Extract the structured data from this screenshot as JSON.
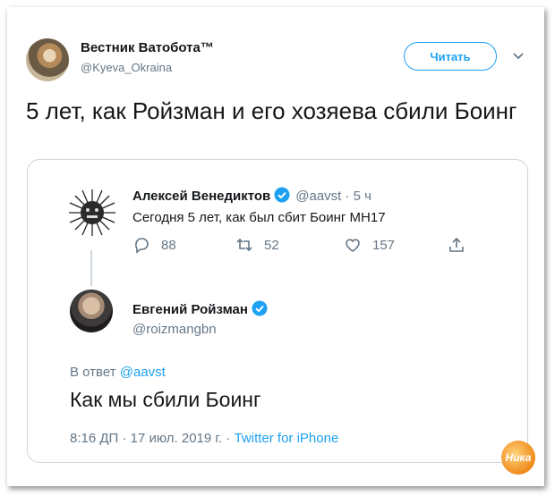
{
  "tweet": {
    "author_name": "Вестник Ватобота™",
    "author_handle": "@Kyeva_Okraina",
    "follow_label": "Читать",
    "text": "5 лет, как Ройзман и его хозяева сбили Боинг"
  },
  "quoted": {
    "parent": {
      "name": "Алексей Венедиктов",
      "meta": "@aavst · 5 ч",
      "text": "Сегодня 5 лет, как был сбит Боинг MH17",
      "replies": "88",
      "retweets": "52",
      "likes": "157"
    },
    "reply": {
      "name": "Евгений Ройзман",
      "handle": "@roizmangbn",
      "reply_to_prefix": "В ответ",
      "reply_to_handle": "@aavst",
      "text": "Как мы сбили Боинг",
      "timestamp": "8:16 ДП · 17 июл. 2019 г. ·",
      "via": "Twitter for iPhone"
    }
  },
  "watermark": "Ника",
  "icons": {
    "verified": "verified-badge-icon",
    "reply": "reply-icon",
    "retweet": "retweet-icon",
    "like": "heart-icon",
    "share": "share-icon",
    "caret": "chevron-down-icon"
  },
  "colors": {
    "accent": "#1da1f2",
    "muted": "#657786",
    "border": "#ccd6dd"
  }
}
